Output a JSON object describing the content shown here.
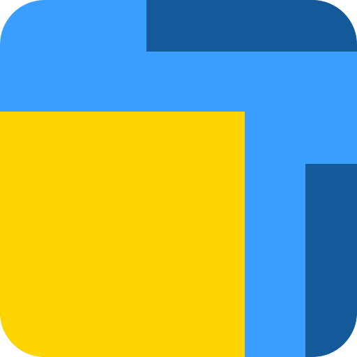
{
  "icon": {
    "colors": {
      "background": "#3A9EFF",
      "dark_accent": "#145A9B",
      "yellow": "#FFD500"
    }
  }
}
